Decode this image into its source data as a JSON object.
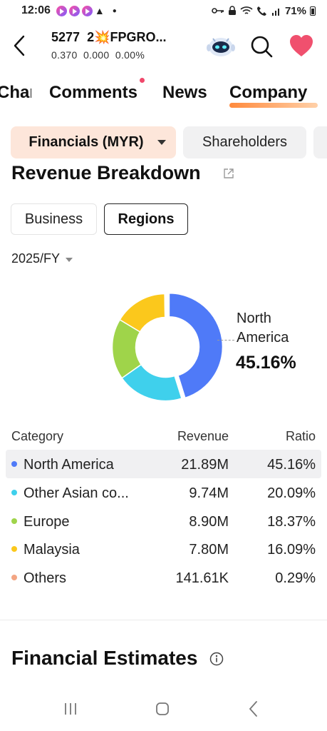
{
  "status_bar": {
    "time": "12:06",
    "battery": "71%",
    "icons": [
      "media-app-icon",
      "media-app-icon",
      "media-app-icon",
      "warning-icon",
      "dot-icon",
      "key-icon",
      "lock-icon",
      "wifi-icon",
      "call-icon",
      "signal-icon",
      "battery-icon"
    ]
  },
  "header": {
    "stock_code": "5277",
    "stock_name_prefix": "2",
    "stock_name_burst": "💥",
    "stock_name_suffix": "FPGRO...",
    "price": "0.370",
    "change": "0.000",
    "change_pct": "0.00%",
    "robot_icon": "robot-assistant-icon",
    "search_icon": "search-icon",
    "favorite_icon": "heart-icon",
    "favorite_color": "#f0506e"
  },
  "tabs": {
    "chart": "Chart",
    "comments": "Comments",
    "news": "News",
    "company": "Company",
    "active": "Company",
    "accent_color": "#ff8a3d"
  },
  "subtabs": {
    "financials": "Financials (MYR)",
    "shareholders": "Shareholders"
  },
  "section": {
    "title": "Revenue Breakdown"
  },
  "segment": {
    "business": "Business",
    "regions": "Regions",
    "active": "Regions"
  },
  "period": {
    "value": "2025/FY"
  },
  "callout": {
    "label": "North America",
    "pct": "45.16%"
  },
  "chart_data": {
    "type": "pie",
    "donut": true,
    "categories": [
      "North America",
      "Other Asian co...",
      "Europe",
      "Malaysia",
      "Others"
    ],
    "values": [
      45.16,
      20.09,
      18.37,
      16.09,
      0.29
    ],
    "colors": [
      "#4f7af8",
      "#3fd0ec",
      "#9fd44a",
      "#fbc81c",
      "#f3a583"
    ]
  },
  "table": {
    "headers": {
      "category": "Category",
      "revenue": "Revenue",
      "ratio": "Ratio"
    },
    "rows": [
      {
        "category": "North America",
        "revenue": "21.89M",
        "ratio": "45.16%",
        "color": "#4f7af8"
      },
      {
        "category": "Other Asian co...",
        "revenue": "9.74M",
        "ratio": "20.09%",
        "color": "#3fd0ec"
      },
      {
        "category": "Europe",
        "revenue": "8.90M",
        "ratio": "18.37%",
        "color": "#9fd44a"
      },
      {
        "category": "Malaysia",
        "revenue": "7.80M",
        "ratio": "16.09%",
        "color": "#fbc81c"
      },
      {
        "category": "Others",
        "revenue": "141.61K",
        "ratio": "0.29%",
        "color": "#f3a583"
      }
    ]
  },
  "estimates": {
    "title": "Financial Estimates"
  }
}
